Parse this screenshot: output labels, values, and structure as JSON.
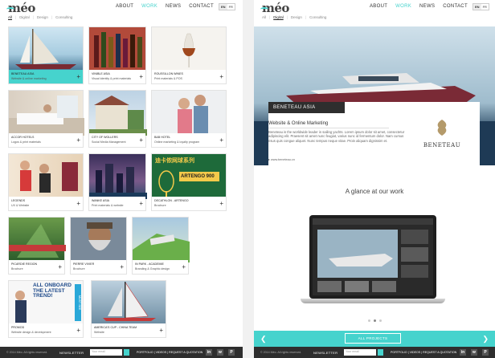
{
  "brand": {
    "logo_text": "méo"
  },
  "nav": [
    "ABOUT",
    "WORK",
    "NEWS",
    "CONTACT"
  ],
  "nav_active": "WORK",
  "lang": [
    "EN",
    "FR"
  ],
  "filters": [
    "All",
    "Digital",
    "Design",
    "Consulting"
  ],
  "cards": [
    {
      "title": "BENETEAU ASIA",
      "subtitle": "Website & online marketing",
      "highlight": true,
      "scene": "yacht"
    },
    {
      "title": "VINIBLE ASIA",
      "subtitle": "Visual identity & print materials",
      "scene": "bottles"
    },
    {
      "title": "ROUSSILLON WINES",
      "subtitle": "Print materials & POS",
      "scene": "wineglass"
    },
    {
      "title": "ACCOR HOTELS",
      "subtitle": "Logos & print materials",
      "scene": "hotel"
    },
    {
      "title": "CITY OF WOLLERS",
      "subtitle": "Social Media Management",
      "scene": "building"
    },
    {
      "title": "B&B HOTEL",
      "subtitle": "Online marketing & loyalty program",
      "scene": "couple"
    },
    {
      "title": "LEGENDS",
      "subtitle": "UX & Website",
      "scene": "party"
    },
    {
      "title": "WANKE ASIA",
      "subtitle": "Print materials & website",
      "scene": "city"
    },
    {
      "title": "DECATHLON - ARTENGO",
      "subtitle": "Brochure",
      "scene": "poster"
    },
    {
      "title": "PICARDIE REGION",
      "subtitle": "Brochure",
      "scene": "greenhouse"
    },
    {
      "title": "PIERRE VIVIER",
      "subtitle": "Brochure",
      "scene": "bearded"
    },
    {
      "title": "IN PARK - ACADEMIE",
      "subtitle": "Branding & Graphic design",
      "scene": "aerial"
    },
    {
      "title": "PROMOD",
      "subtitle": "Website design & development",
      "scene": "onboard"
    },
    {
      "title": "AMERICA'S CUP - CHINA TEAM",
      "subtitle": "Website",
      "scene": "sailboat"
    }
  ],
  "promo": {
    "headline": "ALL ONBOARD THE LATEST TREND!",
    "side_text": "MUST SEE"
  },
  "artengo_poster": {
    "brand": "ARTENGO 900",
    "chinese": "迪卡侬网球系列"
  },
  "footer": {
    "copyright": "© 2014 Méo. All rights reserved.",
    "newsletter_label": "NEWSLETTER",
    "email_placeholder": "Your email",
    "links": "PORTFOLIO | VIDEOS | REQUEST A QUOTATION",
    "social": [
      "in",
      "w",
      "P"
    ]
  },
  "project": {
    "title": "BENETEAU ASIA",
    "subtitle": "Website & Online Marketing",
    "body": "Beneteau is the worldwide leader in sailing yachts. Lorem ipsum dolor sit amet, consectetur adipiscing elit. Praesent sit amet nunc feugiat, varius nunc id fermentum dolor. Nam cursus risus quis congue aliquet. Nunc tempus neque vitae. Proin aliquam dignissim et.",
    "link": "www.beneteau.cn",
    "brand_name": "BENETEAU",
    "glance_title": "A glance at our work",
    "all_projects": "ALL PROJECTS",
    "slide_count": 3,
    "active_slide": 1
  },
  "colors": {
    "accent": "#46d3cd",
    "dark": "#2e2e2e"
  }
}
